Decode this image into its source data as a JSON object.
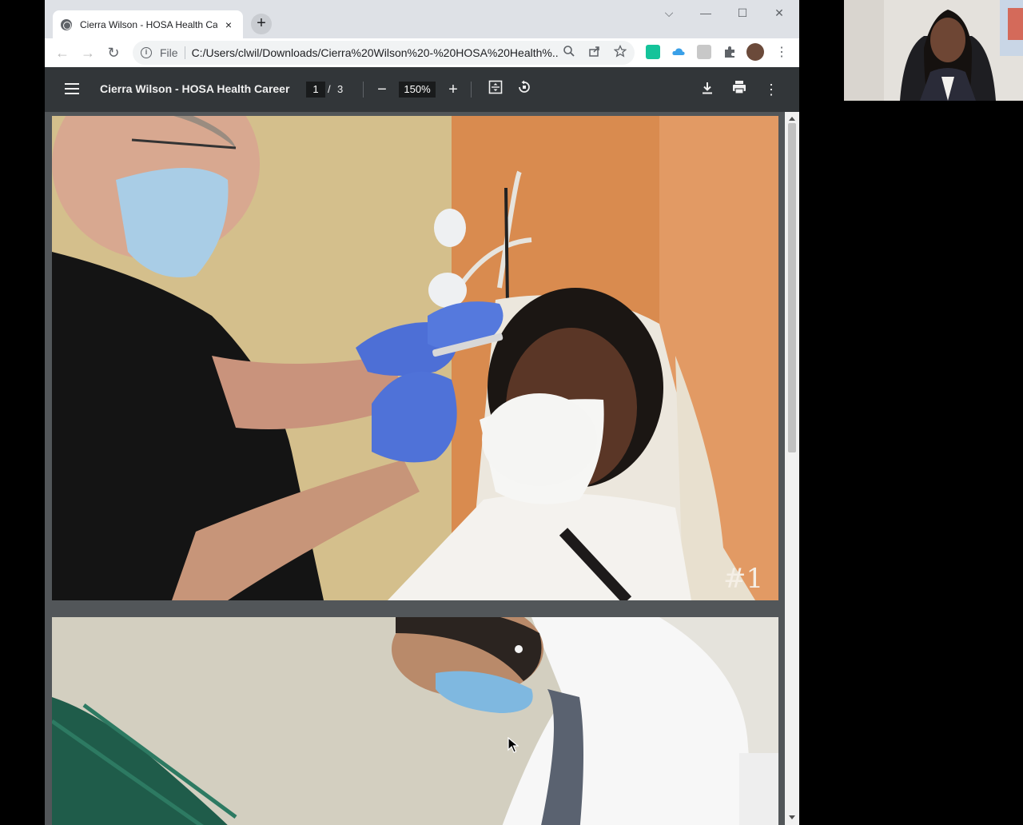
{
  "browser": {
    "tab_title": "Cierra Wilson - HOSA Health Car",
    "tab_close": "×",
    "new_tab": "+",
    "window_controls": {
      "dropdown": "⌵",
      "minimize": "—",
      "maximize": "☐",
      "close": "✕"
    },
    "nav": {
      "back": "←",
      "forward": "→",
      "reload": "↻"
    },
    "omnibox": {
      "scheme": "File",
      "url": "C:/Users/clwil/Downloads/Cierra%20Wilson%20-%20HOSA%20Health%..."
    },
    "extensions": [
      "grammarly-icon",
      "onedrive-icon",
      "extension-icon",
      "puzzle-icon",
      "profile-avatar"
    ],
    "menu": "⋮"
  },
  "pdf_viewer": {
    "title": "Cierra Wilson - HOSA Health Career ...",
    "current_page": "1",
    "page_separator": "/",
    "total_pages": "3",
    "zoom_out": "−",
    "zoom": "150%",
    "zoom_in": "+",
    "page1_label": "#1"
  },
  "colors": {
    "pdf_toolbar_bg": "#323639",
    "viewer_bg": "#525659",
    "tabstrip_bg": "#dee1e6"
  }
}
